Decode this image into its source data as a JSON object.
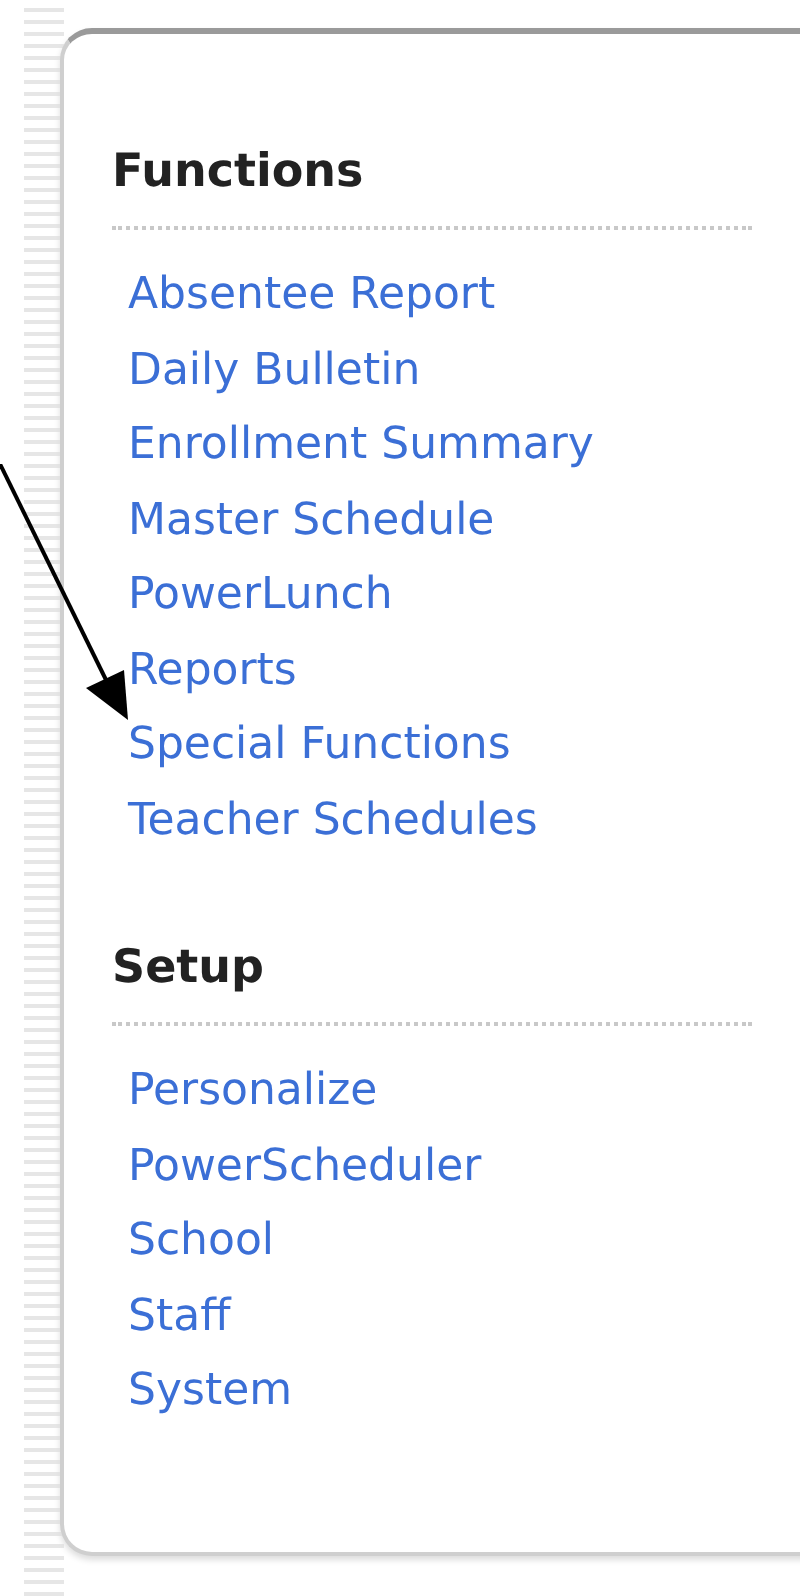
{
  "sections": [
    {
      "title": "Functions",
      "items": [
        "Absentee Report",
        "Daily Bulletin",
        "Enrollment Summary",
        "Master Schedule",
        "PowerLunch",
        "Reports",
        "Special Functions",
        "Teacher Schedules"
      ]
    },
    {
      "title": "Setup",
      "items": [
        "Personalize",
        "PowerScheduler",
        "School",
        "Staff",
        "System"
      ]
    }
  ]
}
